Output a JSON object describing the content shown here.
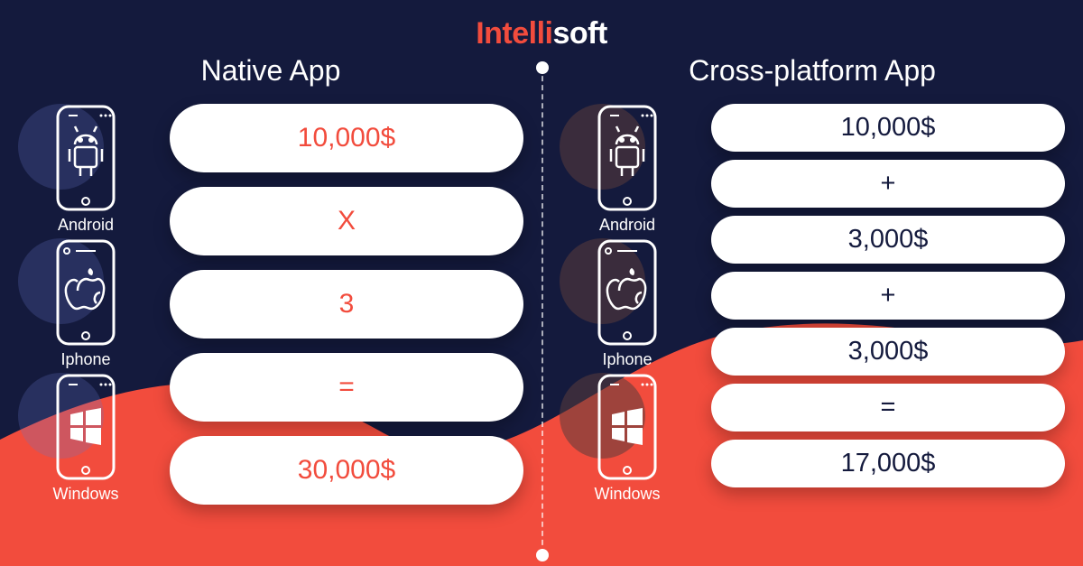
{
  "brand": {
    "accent": "Intelli",
    "rest": "soft"
  },
  "native": {
    "title": "Native App",
    "platforms": [
      {
        "name": "Android",
        "icon": "android"
      },
      {
        "name": "Iphone",
        "icon": "apple"
      },
      {
        "name": "Windows",
        "icon": "windows"
      }
    ],
    "pills": [
      "10,000$",
      "X",
      "3",
      "=",
      "30,000$"
    ]
  },
  "cross": {
    "title": "Cross-platform App",
    "platforms": [
      {
        "name": "Android",
        "icon": "android"
      },
      {
        "name": "Iphone",
        "icon": "apple"
      },
      {
        "name": "Windows",
        "icon": "windows"
      }
    ],
    "pills": [
      "10,000$",
      "+",
      "3,000$",
      "+",
      "3,000$",
      "=",
      "17,000$"
    ]
  }
}
